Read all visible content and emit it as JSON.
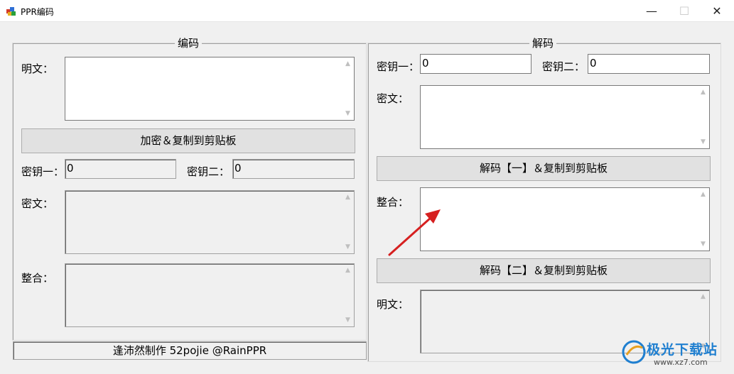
{
  "window": {
    "title": "PPR编码",
    "minimize_icon": "—",
    "maximize_icon": "☐",
    "close_icon": "✕"
  },
  "encode": {
    "group_title": "编码",
    "plaintext_label": "明文：",
    "plaintext_value": "",
    "encrypt_button": "加密＆复制到剪贴板",
    "key1_label": "密钥一：",
    "key1_value": "0",
    "key2_label": "密钥二：",
    "key2_value": "0",
    "ciphertext_label": "密文：",
    "ciphertext_value": "",
    "combined_label": "整合：",
    "combined_value": ""
  },
  "decode": {
    "group_title": "解码",
    "key1_label": "密钥一：",
    "key1_value": "0",
    "key2_label": "密钥二：",
    "key2_value": "0",
    "ciphertext_label": "密文：",
    "ciphertext_value": "",
    "decrypt1_button": "解码【一】＆复制到剪贴板",
    "combined_label": "整合：",
    "combined_value": "",
    "decrypt2_button": "解码【二】＆复制到剪贴板",
    "plaintext_label": "明文：",
    "plaintext_value": ""
  },
  "status": {
    "text": "逢沛然制作    52pojie @RainPPR"
  },
  "watermark": {
    "title": "极光下载站",
    "url": "www.xz7.com"
  },
  "colors": {
    "arrow": "#d62020",
    "watermark_blue": "#1f7fd0"
  }
}
